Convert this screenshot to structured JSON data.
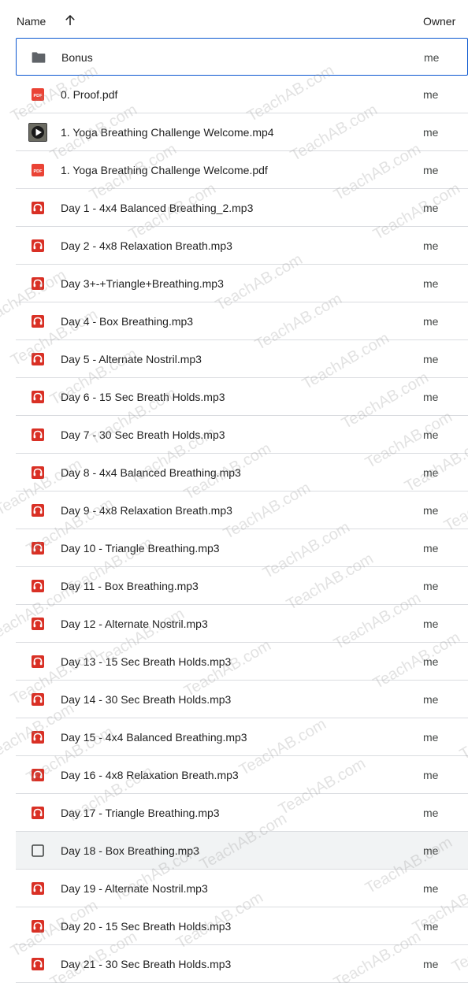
{
  "header": {
    "name_label": "Name",
    "owner_label": "Owner",
    "sort_icon": "arrow-up-icon"
  },
  "watermark": "TeachAB.com",
  "colors": {
    "pdf": "#ea4335",
    "audio": "#d93025",
    "folder": "#5f6368",
    "selected_border": "#0b57d0",
    "hover_bg": "#f1f3f4"
  },
  "files": [
    {
      "name": "Bonus",
      "owner": "me",
      "type": "folder"
    },
    {
      "name": "0. Proof.pdf",
      "owner": "me",
      "type": "pdf"
    },
    {
      "name": "1. Yoga Breathing Challenge Welcome.mp4",
      "owner": "me",
      "type": "video"
    },
    {
      "name": "1. Yoga Breathing Challenge Welcome.pdf",
      "owner": "me",
      "type": "pdf"
    },
    {
      "name": "Day 1 - 4x4 Balanced Breathing_2.mp3",
      "owner": "me",
      "type": "audio"
    },
    {
      "name": "Day 2 - 4x8 Relaxation Breath.mp3",
      "owner": "me",
      "type": "audio"
    },
    {
      "name": "Day 3+-+Triangle+Breathing.mp3",
      "owner": "me",
      "type": "audio"
    },
    {
      "name": "Day 4 - Box Breathing.mp3",
      "owner": "me",
      "type": "audio"
    },
    {
      "name": "Day 5 - Alternate Nostril.mp3",
      "owner": "me",
      "type": "audio"
    },
    {
      "name": "Day 6 - 15 Sec Breath Holds.mp3",
      "owner": "me",
      "type": "audio"
    },
    {
      "name": "Day 7 - 30 Sec Breath Holds.mp3",
      "owner": "me",
      "type": "audio"
    },
    {
      "name": "Day 8 - 4x4 Balanced Breathing.mp3",
      "owner": "me",
      "type": "audio"
    },
    {
      "name": "Day 9 - 4x8 Relaxation Breath.mp3",
      "owner": "me",
      "type": "audio"
    },
    {
      "name": "Day 10 - Triangle Breathing.mp3",
      "owner": "me",
      "type": "audio"
    },
    {
      "name": "Day 11 - Box Breathing.mp3",
      "owner": "me",
      "type": "audio"
    },
    {
      "name": "Day 12 - Alternate Nostril.mp3",
      "owner": "me",
      "type": "audio"
    },
    {
      "name": "Day 13 - 15 Sec Breath Holds.mp3",
      "owner": "me",
      "type": "audio"
    },
    {
      "name": "Day 14 - 30 Sec Breath Holds.mp3",
      "owner": "me",
      "type": "audio"
    },
    {
      "name": "Day 15 - 4x4 Balanced Breathing.mp3",
      "owner": "me",
      "type": "audio"
    },
    {
      "name": "Day 16 - 4x8 Relaxation Breath.mp3",
      "owner": "me",
      "type": "audio"
    },
    {
      "name": "Day 17 - Triangle Breathing.mp3",
      "owner": "me",
      "type": "audio"
    },
    {
      "name": "Day 18 - Box Breathing.mp3",
      "owner": "me",
      "type": "checkbox"
    },
    {
      "name": "Day 19 - Alternate Nostril.mp3",
      "owner": "me",
      "type": "audio"
    },
    {
      "name": "Day 20 - 15 Sec Breath Holds.mp3",
      "owner": "me",
      "type": "audio"
    },
    {
      "name": "Day 21 - 30 Sec Breath Holds.mp3",
      "owner": "me",
      "type": "audio"
    }
  ]
}
